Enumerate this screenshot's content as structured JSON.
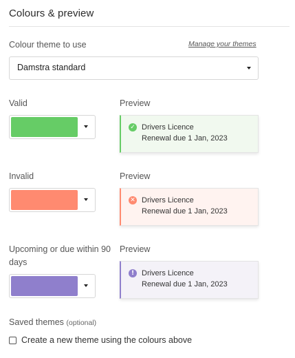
{
  "section": {
    "title": "Colours & preview"
  },
  "theme": {
    "label": "Colour theme to use",
    "manage_link": "Manage your themes",
    "selected": "Damstra standard"
  },
  "states": [
    {
      "label": "Valid",
      "preview_label": "Preview",
      "swatch_color": "#66cc66",
      "card_bg": "#f1f9ef",
      "card_accent": "#66cc66",
      "icon": "check-circle-icon",
      "icon_glyph": "✓",
      "item_title": "Drivers Licence",
      "item_detail": "Renewal due 1 Jan, 2023"
    },
    {
      "label": "Invalid",
      "preview_label": "Preview",
      "swatch_color": "#ff8a70",
      "card_bg": "#fff3f0",
      "card_accent": "#ff8a70",
      "icon": "x-circle-icon",
      "icon_glyph": "✕",
      "item_title": "Drivers Licence",
      "item_detail": "Renewal due 1 Jan, 2023"
    },
    {
      "label": "Upcoming or due within 90 days",
      "preview_label": "Preview",
      "swatch_color": "#8f7fcc",
      "card_bg": "#f4f2f8",
      "card_accent": "#8f7fcc",
      "icon": "exclamation-circle-icon",
      "icon_glyph": "!",
      "item_title": "Drivers Licence",
      "item_detail": "Renewal due 1 Jan, 2023"
    }
  ],
  "saved_themes": {
    "label": "Saved themes",
    "optional": "(optional)",
    "checkbox_label": "Create a new theme using the colours above",
    "checked": false
  }
}
